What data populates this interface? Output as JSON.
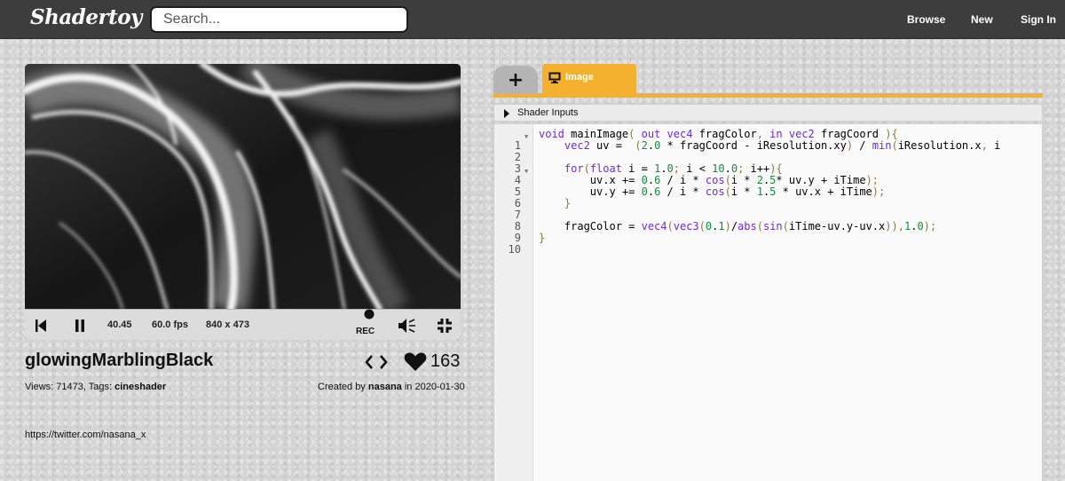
{
  "header": {
    "logo": "Shadertoy",
    "search_placeholder": "Search...",
    "nav": [
      "Browse",
      "New",
      "Sign In"
    ]
  },
  "player": {
    "time": "40.45",
    "fps": "60.0 fps",
    "resolution": "840 x 473",
    "rec_label": "REC"
  },
  "shader": {
    "title": "glowingMarblingBlack",
    "likes": "163",
    "views_label": "Views: 71473, Tags:",
    "tag": "cineshader",
    "created_by_label": "Created by",
    "author": "nasana",
    "date_label": "in 2020-01-30",
    "description_link": "https://twitter.com/nasana_x"
  },
  "editor": {
    "tabs": [
      "+",
      "Image"
    ],
    "inputs_label": "Shader Inputs",
    "code_lines": [
      "void mainImage( out vec4 fragColor, in vec2 fragCoord ){",
      "    vec2 uv =  (2.0 * fragCoord - iResolution.xy) / min(iResolution.x, i",
      "",
      "    for(float i = 1.0; i < 10.0; i++){",
      "        uv.x += 0.6 / i * cos(i * 2.5* uv.y + iTime);",
      "        uv.y += 0.6 / i * cos(i * 1.5 * uv.x + iTime);",
      "    }",
      "",
      "    fragColor = vec4(vec3(0.1)/abs(sin(iTime-uv.y-uv.x)),1.0);",
      "}"
    ],
    "line_numbers": [
      "1",
      "2",
      "3",
      "4",
      "5",
      "6",
      "7",
      "8",
      "9",
      "10"
    ]
  },
  "colors": {
    "topbar": "#3d3d3d",
    "accent_tab": "#f4b12f",
    "keyword": "#6c2bd9",
    "number": "#178a3f"
  }
}
